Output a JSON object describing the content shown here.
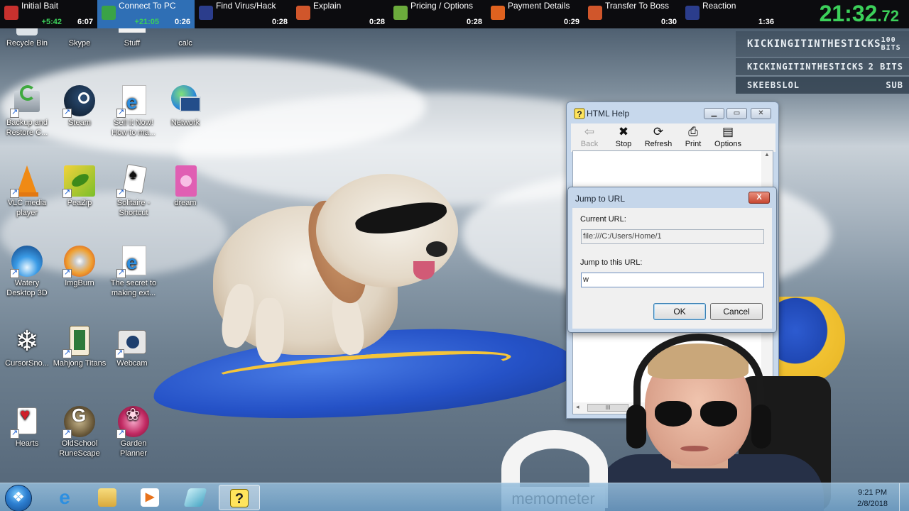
{
  "splits": [
    {
      "name": "Initial Bait",
      "delta": "+5:42",
      "time": "6:07",
      "active": false,
      "icon": "red-folder-icon",
      "color": "#c8312e"
    },
    {
      "name": "Connect To PC",
      "delta": "+21:05",
      "time": "0:26",
      "active": true,
      "icon": "shield-icon",
      "color": "#3aa346"
    },
    {
      "name": "Find Virus/Hack",
      "delta": "",
      "time": "0:28",
      "active": false,
      "icon": "virus-face-icon",
      "color": "#2b3d8c"
    },
    {
      "name": "Explain",
      "delta": "",
      "time": "0:28",
      "active": false,
      "icon": "scroll-icon",
      "color": "#d0562b"
    },
    {
      "name": "Pricing / Options",
      "delta": "",
      "time": "0:28",
      "active": false,
      "icon": "money-icon",
      "color": "#6bab3c"
    },
    {
      "name": "Payment Details",
      "delta": "",
      "time": "0:29",
      "active": false,
      "icon": "fire-icon",
      "color": "#e0621f"
    },
    {
      "name": "Transfer To Boss",
      "delta": "",
      "time": "0:30",
      "active": false,
      "icon": "transfer-icon",
      "color": "#d0562b"
    },
    {
      "name": "Reaction",
      "delta": "",
      "time": "1:36",
      "active": false,
      "icon": "blue-face-icon",
      "color": "#2b3d8c"
    }
  ],
  "timer": {
    "main": "21:32",
    "fraction": ".72"
  },
  "alerts": [
    {
      "name": "KICKINGITINTHESTICKS",
      "value": "100 BITS"
    },
    {
      "name": "KICKINGITINTHESTICKS",
      "value": "2 BITS"
    },
    {
      "name": "SKEEBSLOL",
      "value": "SUB"
    }
  ],
  "desktop_icons": {
    "recycle": "Recycle Bin",
    "skype": "Skype",
    "stuff": "Stuff",
    "calc": "calc",
    "backup": "Backup and Restore C...",
    "steam": "Steam",
    "sellit": "Sell It Now! How to ma...",
    "network": "Network",
    "vlc": "VLC media player",
    "peazip": "PeaZip",
    "solitaire": "Solitaire - Shortcut",
    "dream": "dream",
    "watery": "Watery Desktop 3D",
    "imgburn": "ImgBurn",
    "secret": "The secret to making ext...",
    "cursorsnow": "CursorSno...",
    "mahjong": "Mahjong Titans",
    "webcam": "Webcam",
    "hearts": "Hearts",
    "osrs": "OldSchool RuneScape",
    "garden": "Garden Planner"
  },
  "help_window": {
    "title": "HTML Help",
    "toolbar": {
      "back": "Back",
      "stop": "Stop",
      "refresh": "Refresh",
      "print": "Print",
      "options": "Options"
    },
    "scroll_thumb": "III"
  },
  "jump_dialog": {
    "title": "Jump to URL",
    "close": "X",
    "current_label": "Current URL:",
    "current_value": "file:///C:/Users/Home/1",
    "jump_label": "Jump to this URL:",
    "jump_value": "w",
    "ok": "OK",
    "cancel": "Cancel"
  },
  "overlay": {
    "logo": "memometer"
  },
  "taskbar": {
    "time": "9:21 PM",
    "date": "2/8/2018"
  }
}
